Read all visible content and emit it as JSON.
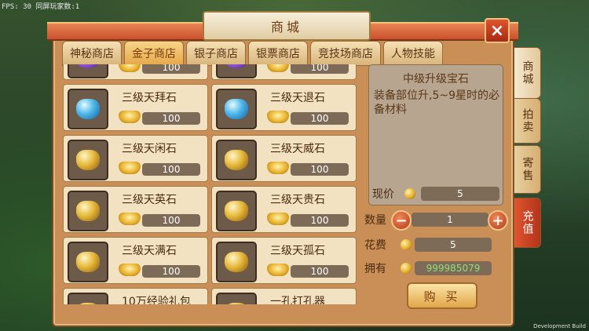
{
  "debug": {
    "fps_text": "FPS: 30 同屏玩家数:1",
    "build_label": "Development Build"
  },
  "window": {
    "title": "商城",
    "close_icon": "×"
  },
  "tabs": [
    {
      "label": "神秘商店",
      "active": false
    },
    {
      "label": "金子商店",
      "active": true
    },
    {
      "label": "银子商店",
      "active": false
    },
    {
      "label": "银票商店",
      "active": false
    },
    {
      "label": "竞技场商店",
      "active": false
    },
    {
      "label": "人物技能",
      "active": false
    }
  ],
  "side_tabs": {
    "shop": "商城",
    "auction": "拍卖",
    "consign": "寄售",
    "recharge": "充值"
  },
  "items": [
    {
      "name": "",
      "price": "100",
      "gem": "purple"
    },
    {
      "name": "",
      "price": "100",
      "gem": "purple"
    },
    {
      "name": "三级天拜石",
      "price": "100",
      "gem": "blue"
    },
    {
      "name": "三级天退石",
      "price": "100",
      "gem": "blue"
    },
    {
      "name": "三级天闲石",
      "price": "100",
      "gem": "gold"
    },
    {
      "name": "三级天威石",
      "price": "100",
      "gem": "gold"
    },
    {
      "name": "三级天英石",
      "price": "100",
      "gem": "gold"
    },
    {
      "name": "三级天贵石",
      "price": "100",
      "gem": "gold"
    },
    {
      "name": "三级天满石",
      "price": "100",
      "gem": "gold"
    },
    {
      "name": "三级天孤石",
      "price": "100",
      "gem": "gold"
    },
    {
      "name": "10万经验礼包",
      "price": "",
      "gem": "gold"
    },
    {
      "name": "一孔打孔器",
      "price": "",
      "gem": "gold"
    }
  ],
  "detail": {
    "title": "中级升级宝石",
    "description": "装备部位升,5~9星时的必备材料",
    "current_price_label": "现价",
    "current_price": "5",
    "quantity_label": "数量",
    "quantity": "1",
    "cost_label": "花费",
    "cost": "5",
    "owned_label": "拥有",
    "owned": "999985079",
    "buy_label": "购 买"
  }
}
